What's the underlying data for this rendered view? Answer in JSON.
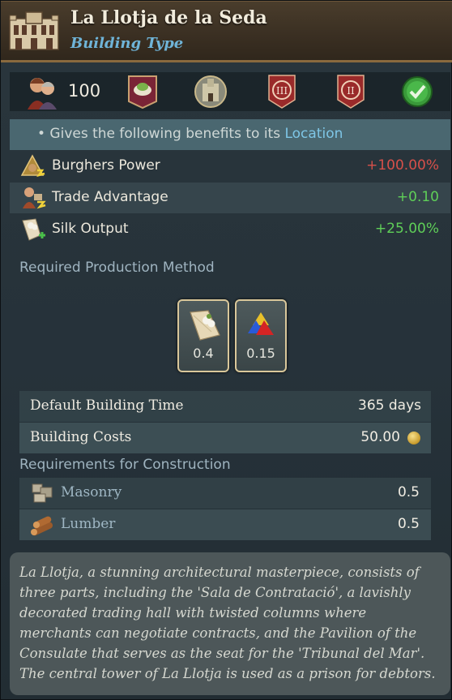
{
  "header": {
    "title": "La Llotja de la Seda",
    "subtitle": "Building Type"
  },
  "icon_row": {
    "population": "100",
    "icons": [
      "population-icon",
      "trade-good-emblem-icon",
      "castle-portrait-icon",
      "tier-three-badge-icon",
      "tier-two-badge-icon",
      "checkmark-badge-icon"
    ]
  },
  "benefits": {
    "intro_prefix": "• Gives the following benefits to its ",
    "intro_link": "Location",
    "modifiers": [
      {
        "label": "Burghers Power",
        "value": "+100.00%",
        "tone": "negative",
        "icon": "burghers-power-icon"
      },
      {
        "label": "Trade Advantage",
        "value": "+0.10",
        "tone": "positive",
        "icon": "trade-advantage-icon"
      },
      {
        "label": "Silk Output",
        "value": "+25.00%",
        "tone": "positive",
        "icon": "silk-output-icon"
      }
    ]
  },
  "production": {
    "heading": "Required Production Method",
    "goods": [
      {
        "icon": "cloth-icon",
        "amount": "0.4"
      },
      {
        "icon": "dyes-icon",
        "amount": "0.15"
      }
    ]
  },
  "build_info": {
    "time_label": "Default Building Time",
    "time_value": "365 days",
    "cost_label": "Building Costs",
    "cost_value": "50.00"
  },
  "requirements": {
    "heading": "Requirements for Construction",
    "items": [
      {
        "label": "Masonry",
        "value": "0.5",
        "icon": "masonry-icon"
      },
      {
        "label": "Lumber",
        "value": "0.5",
        "icon": "lumber-icon"
      }
    ]
  },
  "description": "La Llotja, a stunning architectural masterpiece, consists of three parts, including the 'Sala de Contratació', a lavishly decorated trading hall with twisted columns where merchants can negotiate contracts, and the Pavilion of the Consulate that serves as the seat for the 'Tribunal del Mar'. The central tower of La Llotja is used as a prison for debtors.",
  "colors": {
    "header_bg": "#3a2f22",
    "subtitle": "#6fb4d8",
    "negative": "#d8504a",
    "positive": "#5fcf58",
    "accent_border": "#d9c79a"
  }
}
